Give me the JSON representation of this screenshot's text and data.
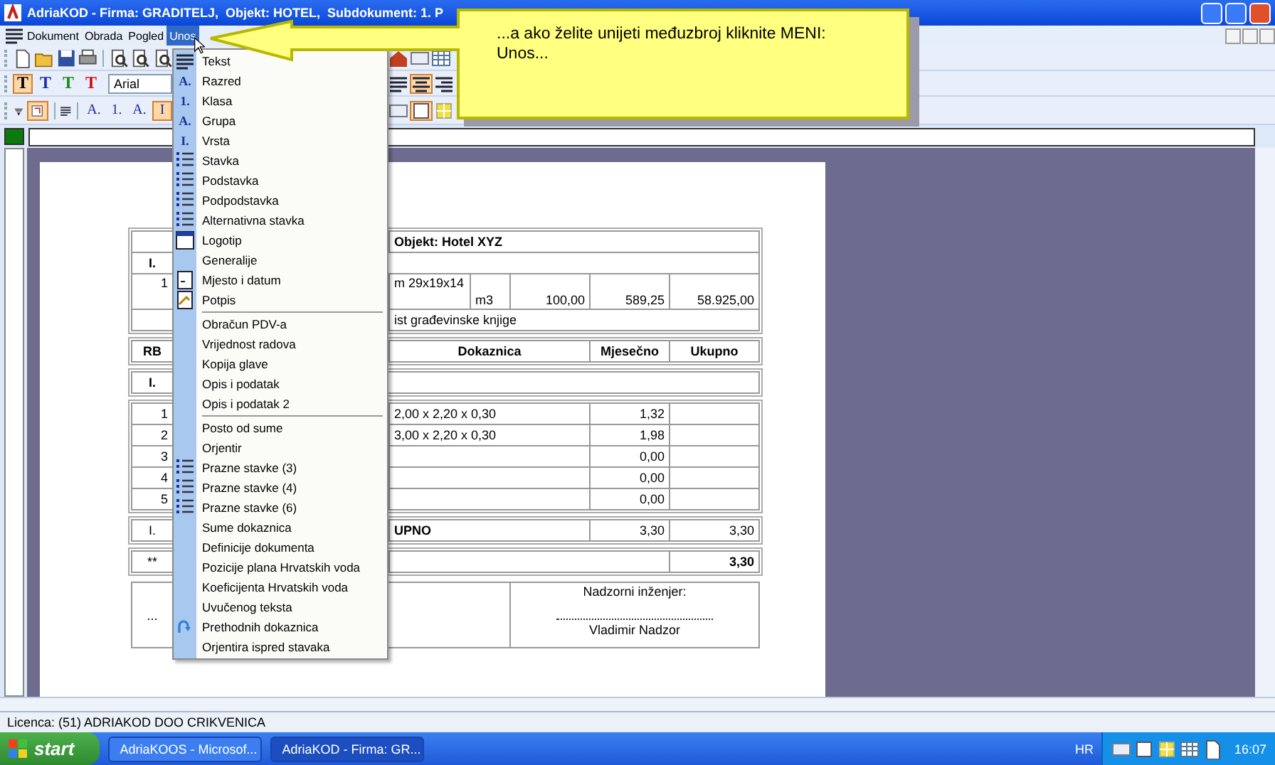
{
  "window": {
    "title": "AdriaKOD - Firma: GRADITELJ,  Objekt: HOTEL,  Subdokument: 1. P"
  },
  "menu_bar": [
    {
      "label": "Dokument",
      "selected": false
    },
    {
      "label": "Obrada",
      "selected": false
    },
    {
      "label": "Pogled",
      "selected": false
    },
    {
      "label": "Unos",
      "selected": true
    }
  ],
  "format_toolbar": {
    "text_buttons": [
      {
        "label": "T",
        "color": "#000000",
        "selected": true
      },
      {
        "label": "T",
        "color": "#1c2fa8",
        "selected": false
      },
      {
        "label": "T",
        "color": "#1a8a1a",
        "selected": false
      },
      {
        "label": "T",
        "color": "#d01010",
        "selected": false
      }
    ],
    "font": "Arial"
  },
  "level_toolbar": [
    {
      "label": "A.",
      "selected": false
    },
    {
      "label": "1.",
      "selected": false
    },
    {
      "label": "A.",
      "selected": false
    },
    {
      "label": "I",
      "selected": true
    }
  ],
  "menu": [
    {
      "kind": "lines",
      "label": "Tekst"
    },
    {
      "kind": "glyph",
      "label": "Razred",
      "glyph": "A."
    },
    {
      "kind": "glyph",
      "label": "Klasa",
      "glyph": "1."
    },
    {
      "kind": "glyph",
      "label": "Grupa",
      "glyph": "A."
    },
    {
      "kind": "glyph",
      "label": "Vrsta",
      "glyph": "I."
    },
    {
      "kind": "list",
      "label": "Stavka"
    },
    {
      "kind": "list",
      "label": "Podstavka"
    },
    {
      "kind": "list",
      "label": "Podpodstavka"
    },
    {
      "kind": "list",
      "label": "Alternativna stavka"
    },
    {
      "kind": "window",
      "label": "Logotip"
    },
    {
      "kind": "plain",
      "label": "Generalije"
    },
    {
      "kind": "page",
      "label": "Mjesto i datum"
    },
    {
      "kind": "signature",
      "label": "Potpis"
    },
    {
      "kind": "separator"
    },
    {
      "kind": "plain",
      "label": "Obračun PDV-a"
    },
    {
      "kind": "plain",
      "label": "Vrijednost radova"
    },
    {
      "kind": "plain",
      "label": "Kopija glave"
    },
    {
      "kind": "plain",
      "label": "Opis i podatak"
    },
    {
      "kind": "plain",
      "label": "Opis i podatak 2"
    },
    {
      "kind": "separator"
    },
    {
      "kind": "plain",
      "label": "Posto od sume"
    },
    {
      "kind": "plain",
      "label": "Orjentir"
    },
    {
      "kind": "list",
      "label": "Prazne stavke (3)"
    },
    {
      "kind": "list",
      "label": "Prazne stavke (4)"
    },
    {
      "kind": "list",
      "label": "Prazne stavke (6)"
    },
    {
      "kind": "plain",
      "label": "Sume dokaznica"
    },
    {
      "kind": "plain",
      "label": "Definicije dokumenta"
    },
    {
      "kind": "plain",
      "label": "Pozicije plana Hrvatskih voda"
    },
    {
      "kind": "plain",
      "label": "Koeficijenta Hrvatskih voda"
    },
    {
      "kind": "plain",
      "label": "Uvučenog teksta"
    },
    {
      "kind": "redo",
      "label": "Prethodnih dokaznica"
    },
    {
      "kind": "plain",
      "label": "Orjentira ispred stavaka"
    }
  ],
  "callout": {
    "text": "...a ako želite unijeti međuzbroj kliknite MENI: Unos..."
  },
  "document": {
    "header_block": {
      "title": "Objekt: Hotel XYZ",
      "group_rb": "I.",
      "item": {
        "rb": "1",
        "description": "m 29x19x14",
        "unit": "m3",
        "quantity": "100,00",
        "price": "589,25",
        "total": "58.925,00"
      },
      "note": "ist građevinske knjige"
    },
    "columns": [
      "RB",
      "Dokaznica",
      "Mjesečno",
      "Ukupno"
    ],
    "group_row": {
      "rb": "I."
    },
    "rows": [
      {
        "rb": "1",
        "dokaznica": "2,00 x 2,20 x 0,30",
        "monthly": "1,32"
      },
      {
        "rb": "2",
        "dokaznica": "3,00 x 2,20 x 0,30",
        "monthly": "1,98"
      },
      {
        "rb": "3",
        "monthly": "0,00"
      },
      {
        "rb": "4",
        "monthly": "0,00"
      },
      {
        "rb": "5",
        "monthly": "0,00"
      }
    ],
    "total_row": {
      "rb": "I.",
      "label": "UPNO",
      "monthly": "3,30",
      "total": "3,30"
    },
    "grand_row": {
      "rb": "**",
      "total": "3,30"
    },
    "signature": {
      "left": "...",
      "title": "Nadzorni inženjer:",
      "name": "Vladimir Nadzor"
    }
  },
  "status_bar": {
    "text": "Licenca: (51) ADRIAKOD DOO CRIKVENICA"
  },
  "taskbar": {
    "start": "start",
    "tasks": [
      {
        "label": "AdriaKOOS - Microsof...",
        "selected": false
      },
      {
        "label": "AdriaKOD - Firma: GR...",
        "selected": true
      }
    ],
    "language": "HR",
    "clock": "16:07"
  }
}
